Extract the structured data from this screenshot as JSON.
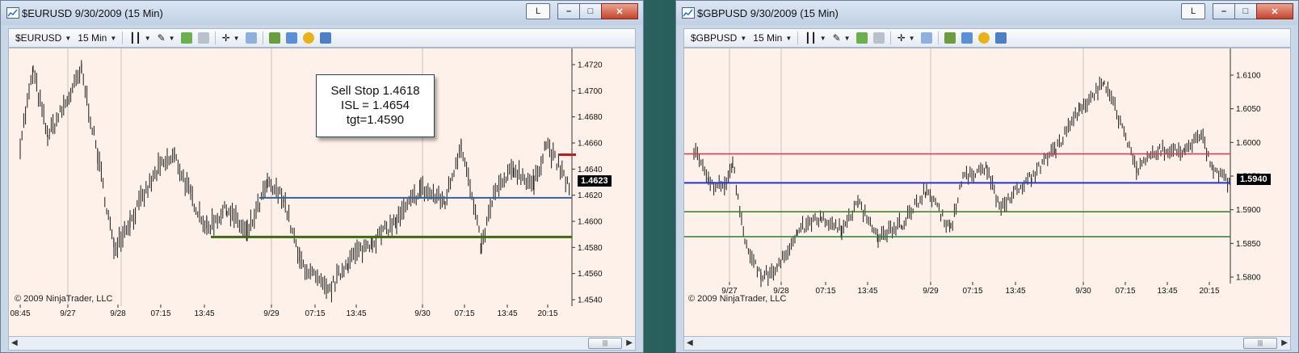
{
  "windows": [
    {
      "title": "$EURUSD  9/30/2009 (15 Min)",
      "instrument": "$EURUSD",
      "interval": "15 Min",
      "link_button": "L",
      "copyright": "© 2009 NinjaTrader, LLC",
      "last_price_tag": "1.4623",
      "annotation": [
        "Sell Stop 1.4618",
        "ISL = 1.4654",
        "tgt=1.4590"
      ],
      "y_ticks": [
        "1.4720",
        "1.4700",
        "1.4680",
        "1.4660",
        "1.4640",
        "1.4620",
        "1.4600",
        "1.4580",
        "1.4560",
        "1.4540"
      ],
      "x_ticks": [
        "08:45",
        "9/27",
        "9/28",
        "07:15",
        "13:45",
        "9/29",
        "07:15",
        "13:45",
        "9/30",
        "07:15",
        "13:45",
        "20:15"
      ],
      "lines": [
        {
          "price": 1.4618,
          "color": "#3a5f98"
        },
        {
          "price": 1.4588,
          "color": "#3c6b12"
        },
        {
          "price": 1.4651,
          "color": "#b71e1e"
        }
      ]
    },
    {
      "title": "$GBPUSD  9/30/2009 (15 Min)",
      "instrument": "$GBPUSD",
      "interval": "15 Min",
      "link_button": "L",
      "copyright": "© 2009 NinjaTrader, LLC",
      "last_price_tag": "1.5940",
      "y_ticks": [
        "1.6100",
        "1.6050",
        "1.6000",
        "1.5950",
        "1.5900",
        "1.5850",
        "1.5800"
      ],
      "x_ticks": [
        "9/27",
        "9/28",
        "07:15",
        "13:45",
        "9/29",
        "07:15",
        "13:45",
        "9/30",
        "07:15",
        "13:45",
        "20:15"
      ],
      "lines": [
        {
          "price": 1.5983,
          "color": "#e0304f"
        },
        {
          "price": 1.594,
          "color": "#2233dd"
        },
        {
          "price": 1.5897,
          "color": "#2f7c25"
        },
        {
          "price": 1.586,
          "color": "#2f7c25"
        }
      ]
    }
  ]
}
